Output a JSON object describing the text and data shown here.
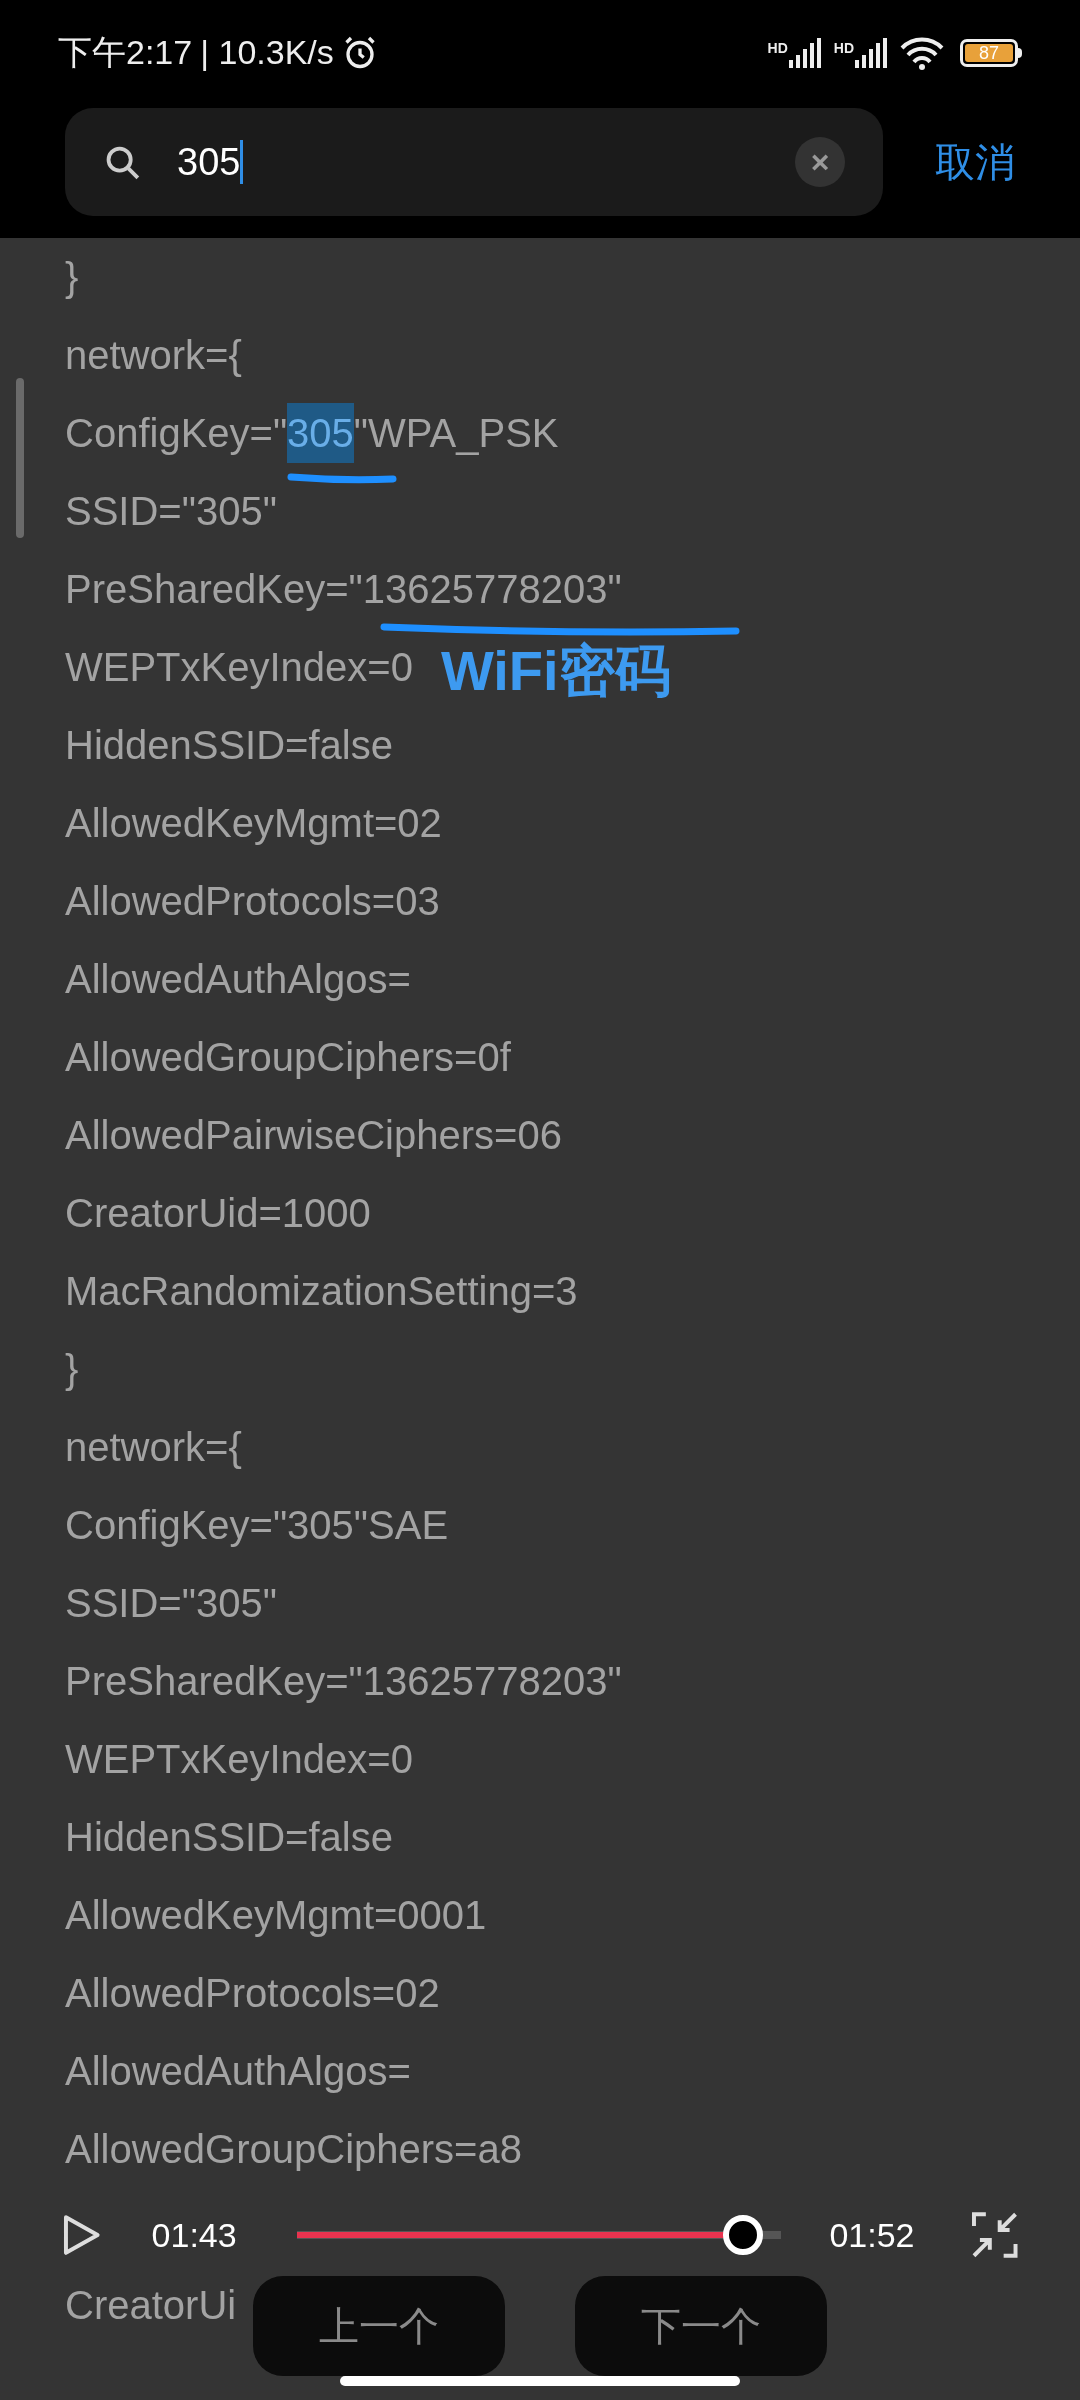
{
  "status_bar": {
    "time": "下午2:17",
    "speed": "| 10.3K/s",
    "network_labels": [
      "HD",
      "HD"
    ],
    "battery": "87"
  },
  "search": {
    "value": "305",
    "clear_button": "×",
    "cancel": "取消"
  },
  "lines": [
    {
      "kind": "plain",
      "text": "}"
    },
    {
      "kind": "plain",
      "text": "network={"
    },
    {
      "kind": "match",
      "before": "ConfigKey=\"",
      "match": "305",
      "after": "\"WPA_PSK"
    },
    {
      "kind": "plain",
      "text": "SSID=\"305\""
    },
    {
      "kind": "underlined",
      "text": "PreSharedKey=\"13625778203\""
    },
    {
      "kind": "plain",
      "text": "WEPTxKeyIndex=0",
      "note": "WiFi密码"
    },
    {
      "kind": "plain",
      "text": "HiddenSSID=false"
    },
    {
      "kind": "plain",
      "text": "AllowedKeyMgmt=02"
    },
    {
      "kind": "plain",
      "text": "AllowedProtocols=03"
    },
    {
      "kind": "plain",
      "text": "AllowedAuthAlgos="
    },
    {
      "kind": "plain",
      "text": "AllowedGroupCiphers=0f"
    },
    {
      "kind": "plain",
      "text": "AllowedPairwiseCiphers=06"
    },
    {
      "kind": "plain",
      "text": "CreatorUid=1000"
    },
    {
      "kind": "plain",
      "text": "MacRandomizationSetting=3"
    },
    {
      "kind": "plain",
      "text": "}"
    },
    {
      "kind": "plain",
      "text": "network={"
    },
    {
      "kind": "plain",
      "text": "ConfigKey=\"305\"SAE"
    },
    {
      "kind": "plain",
      "text": "SSID=\"305\""
    },
    {
      "kind": "plain",
      "text": "PreSharedKey=\"13625778203\""
    },
    {
      "kind": "plain",
      "text": "WEPTxKeyIndex=0"
    },
    {
      "kind": "plain",
      "text": "HiddenSSID=false"
    },
    {
      "kind": "plain",
      "text": "AllowedKeyMgmt=0001"
    },
    {
      "kind": "plain",
      "text": "AllowedProtocols=02"
    },
    {
      "kind": "plain",
      "text": "AllowedAuthAlgos="
    },
    {
      "kind": "plain",
      "text": "AllowedGroupCiphers=a8"
    },
    {
      "kind": "covered"
    },
    {
      "kind": "plain",
      "text": "CreatorUi"
    }
  ],
  "player": {
    "elapsed": "01:43",
    "total": "01:52",
    "level": 0.92
  },
  "nav_buttons": [
    "上一个",
    "下一个"
  ]
}
